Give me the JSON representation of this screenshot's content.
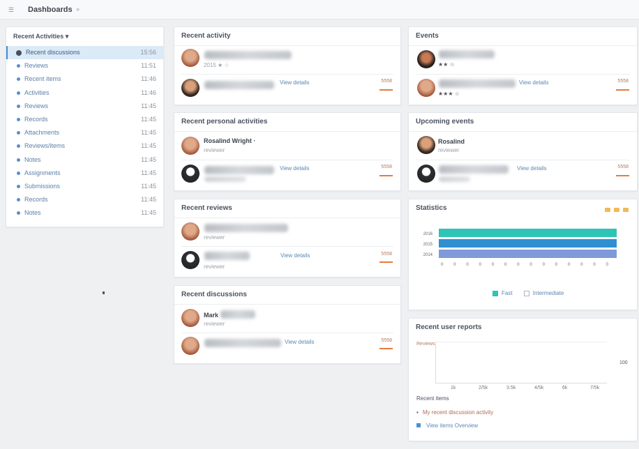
{
  "topbar": {
    "menu_icon": "menu-icon",
    "title": "Dashboards",
    "caret": "»"
  },
  "sidebar": {
    "title": "Recent Activities ▾",
    "items": [
      {
        "label": "Recent discussions",
        "count": "15:56"
      },
      {
        "label": "Reviews",
        "count": "11:51"
      },
      {
        "label": "Recent items",
        "count": "11:46"
      },
      {
        "label": "Activities",
        "count": "11:46"
      },
      {
        "label": "Reviews",
        "count": "11:45"
      },
      {
        "label": "Records",
        "count": "11:45"
      },
      {
        "label": "Attachments",
        "count": "11:45"
      },
      {
        "label": "Reviews/items",
        "count": "11:45"
      },
      {
        "label": "Notes",
        "count": "11:45"
      },
      {
        "label": "Assignments",
        "count": "11:45"
      },
      {
        "label": "Submissions",
        "count": "11:45"
      },
      {
        "label": "Records",
        "count": "11:45"
      },
      {
        "label": "Notes",
        "count": "11:45"
      }
    ]
  },
  "mid": {
    "card1": {
      "title": "Recent activity",
      "row1_sub": "2015 ★ ☆",
      "row2_link": "View details",
      "row2_val": "5558"
    },
    "card2": {
      "title": "Recent personal activities",
      "row1_name": "Rosalind Wright ·",
      "row1_sub": "reviewer",
      "row2_link": "View details",
      "row2_val": "5558"
    },
    "card3": {
      "title": "Recent reviews",
      "row1_sub": "reviewer",
      "row2_sub": "reviewer",
      "row2_link": "View details",
      "row2_val": "5558"
    },
    "card4": {
      "title": "Recent discussions",
      "row1_name": "Mark",
      "row1_sub": "reviewer",
      "row2_link": "View details",
      "row2_val": "5558"
    }
  },
  "right": {
    "card1": {
      "title": "Events",
      "row1_sub": "★★ ☆",
      "row2_sub": "★★★ ☆",
      "row2_link": "View details",
      "row2_val": "5558"
    },
    "card2": {
      "title": "Upcoming events",
      "row1_name": "Rosalind",
      "row1_sub": "reviewer",
      "row2_link": "View details",
      "row2_val": "5558"
    },
    "chart_card": {
      "title": "Statistics"
    },
    "scores_card": {
      "title": "Recent user reports",
      "ylabel": "Reviews",
      "right_label": "100",
      "ticks": [
        "1k",
        "2/5k",
        "3.5k",
        "4/5k",
        "6k",
        "7/5k"
      ],
      "footer_title": "Recent items",
      "item1": "My recent discussion activity",
      "item2": "View items   Overview"
    }
  },
  "chart_data": {
    "type": "bar",
    "orientation": "horizontal",
    "categories": [
      "2016",
      "2015",
      "2014"
    ],
    "series": [
      {
        "name": "Fast",
        "values": [
          100,
          100,
          100
        ],
        "color": "#2ec4b6"
      },
      {
        "name": "Intermediate",
        "values": [
          100,
          100,
          100
        ],
        "color": "#6d8fd6"
      }
    ],
    "category_colors": [
      "#2ec4b6",
      "#2f8fd1",
      "#7e9ad8"
    ],
    "xticks": [
      "0",
      "0",
      "0",
      "0",
      "0",
      "0",
      "0",
      "0",
      "0",
      "0",
      "0",
      "0",
      "0",
      "0"
    ],
    "legend_position": "bottom"
  }
}
